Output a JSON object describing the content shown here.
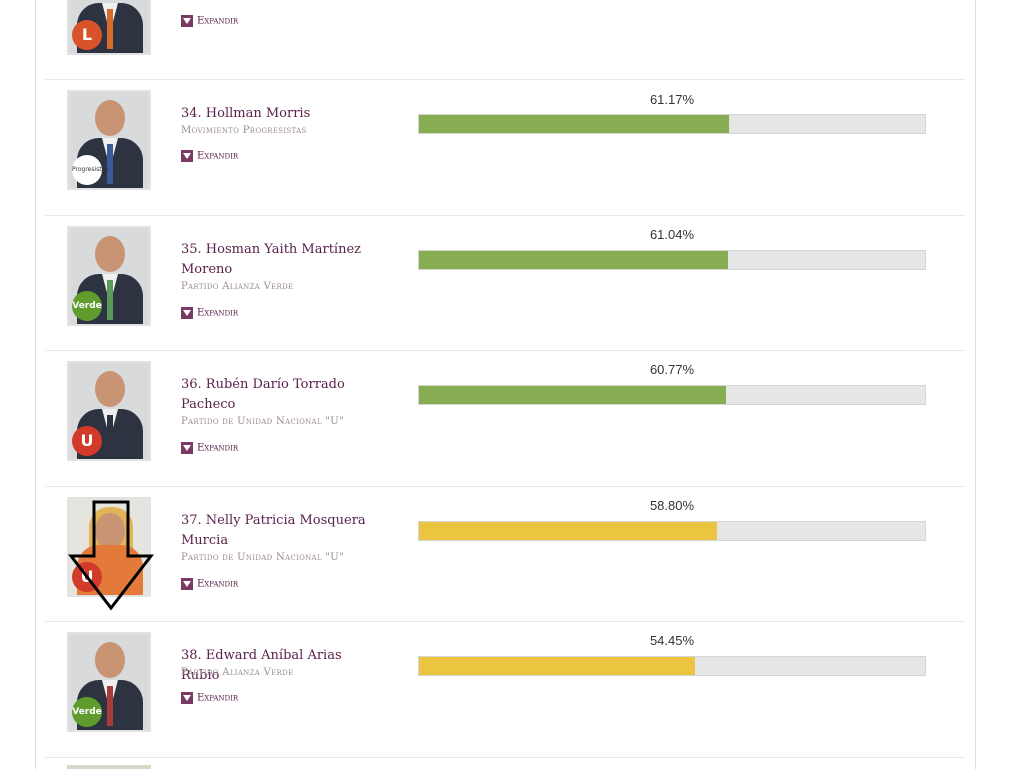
{
  "expand_label": "Expandir",
  "colors": {
    "bar_high": "#86ad52",
    "bar_mid": "#ebc540",
    "track": "#e6e6e6",
    "name": "#5a2149",
    "party": "#9a8a95"
  },
  "top_row": {
    "badge_text": "L",
    "badge_color": "#d8522a"
  },
  "candidates": [
    {
      "name": "34. Hollman Morris",
      "party": "Movimiento Progresistas",
      "percent_label": "61.17%",
      "percent": 61.17,
      "bar_color": "#86ad52",
      "badge_text": "Progresistas",
      "badge_color": "#ffffff",
      "badge_icon": "progresistas-logo"
    },
    {
      "name": "35. Hosman Yaith Martínez Moreno",
      "party": "Partido Alianza Verde",
      "percent_label": "61.04%",
      "percent": 61.04,
      "bar_color": "#86ad52",
      "badge_text": "Verde",
      "badge_color": "#5f9b2d",
      "badge_icon": "verde-logo"
    },
    {
      "name": "36. Rubén Darío Torrado Pacheco",
      "party": "Partido de Unidad Nacional \"U\"",
      "percent_label": "60.77%",
      "percent": 60.77,
      "bar_color": "#86ad52",
      "badge_text": "U",
      "badge_color": "#d23a2a",
      "badge_icon": "u-logo"
    },
    {
      "name": "37. Nelly Patricia Mosquera Murcia",
      "party": "Partido de Unidad Nacional \"U\"",
      "percent_label": "58.80%",
      "percent": 58.8,
      "bar_color": "#ebc540",
      "badge_text": "U",
      "badge_color": "#d23a2a",
      "badge_icon": "u-logo"
    },
    {
      "name": "38. Edward Aníbal Arias Rubio",
      "party": "Partido Alianza Verde",
      "percent_label": "54.45%",
      "percent": 54.45,
      "bar_color": "#ebc540",
      "badge_text": "Verde",
      "badge_color": "#5f9b2d",
      "badge_icon": "verde-logo"
    }
  ]
}
